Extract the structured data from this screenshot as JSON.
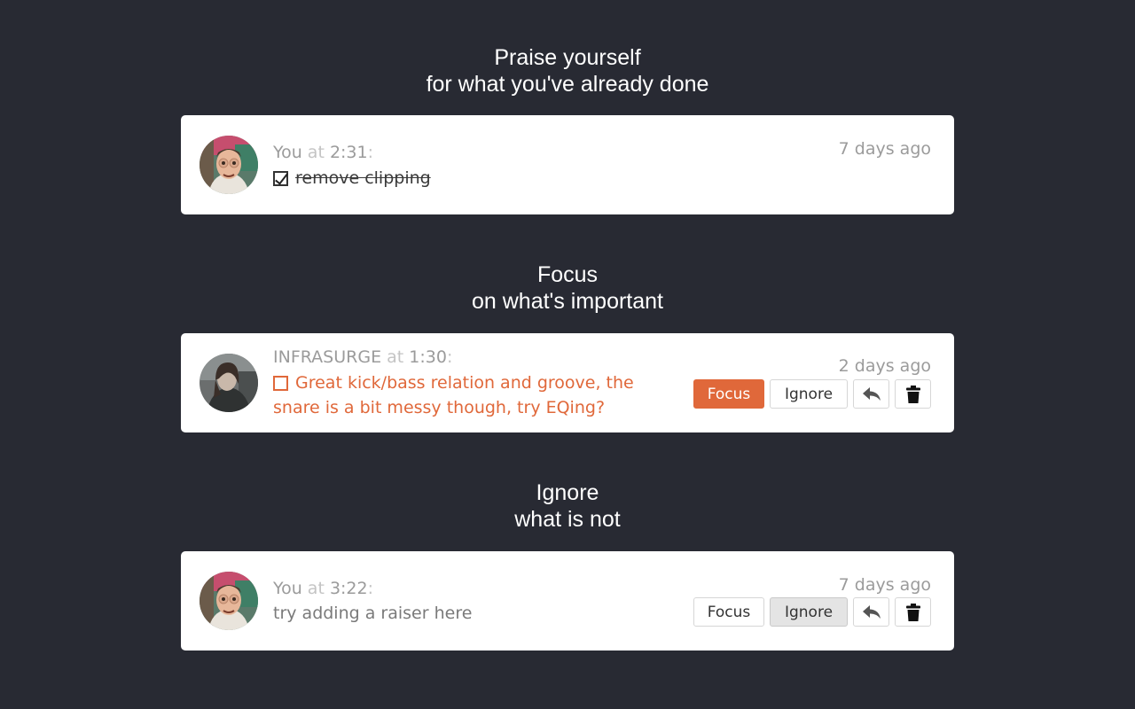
{
  "sections": [
    {
      "heading_line1": "Praise yourself",
      "heading_line2": "for what you've already done",
      "comment": {
        "author": "You",
        "at": "at",
        "time": "2:31",
        "colon": ":",
        "text": "remove clipping",
        "checked": true,
        "ago": "7 days ago"
      }
    },
    {
      "heading_line1": "Focus",
      "heading_line2": "on what's important",
      "comment": {
        "author": "INFRASURGE",
        "at": "at",
        "time": "1:30",
        "colon": ":",
        "text": "Great kick/bass relation and groove, the snare is a bit messy though, try EQing?",
        "checked": false,
        "ago": "2 days ago",
        "state": "focused"
      }
    },
    {
      "heading_line1": "Ignore",
      "heading_line2": "what is not",
      "comment": {
        "author": "You",
        "at": "at",
        "time": "3:22",
        "colon": ":",
        "text": "try adding a raiser here",
        "ago": "7 days ago",
        "state": "ignored"
      }
    }
  ],
  "buttons": {
    "focus_label": "Focus",
    "ignore_label": "Ignore",
    "reply_icon": "reply-icon",
    "delete_icon": "trash-icon"
  },
  "colors": {
    "background": "#282a33",
    "accent": "#e0683a",
    "card": "#ffffff"
  }
}
